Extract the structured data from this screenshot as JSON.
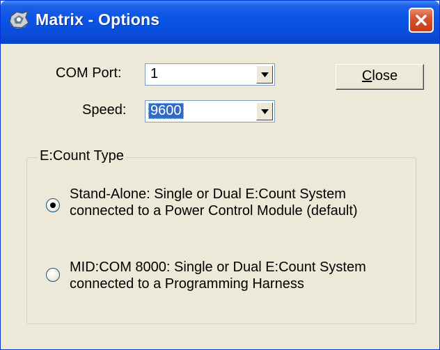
{
  "window": {
    "title": "Matrix - Options"
  },
  "com_port": {
    "label": "COM Port:",
    "value": "1"
  },
  "speed": {
    "label": "Speed:",
    "value": "9600"
  },
  "close_button": {
    "label_prefix": "",
    "label_accel": "C",
    "label_rest": "lose"
  },
  "ecount_type": {
    "title": "E:Count Type",
    "options": [
      {
        "line1": "Stand-Alone: Single or Dual E:Count System",
        "line2": "connected to a Power Control Module (default)",
        "selected": true
      },
      {
        "line1": "MID:COM 8000: Single or Dual E:Count System",
        "line2": "connected to a Programming Harness",
        "selected": false
      }
    ]
  },
  "colors": {
    "titlebar": "#0a4fdd",
    "close_button": "#d8542e",
    "face": "#ece9d8",
    "selection": "#316ac5"
  }
}
